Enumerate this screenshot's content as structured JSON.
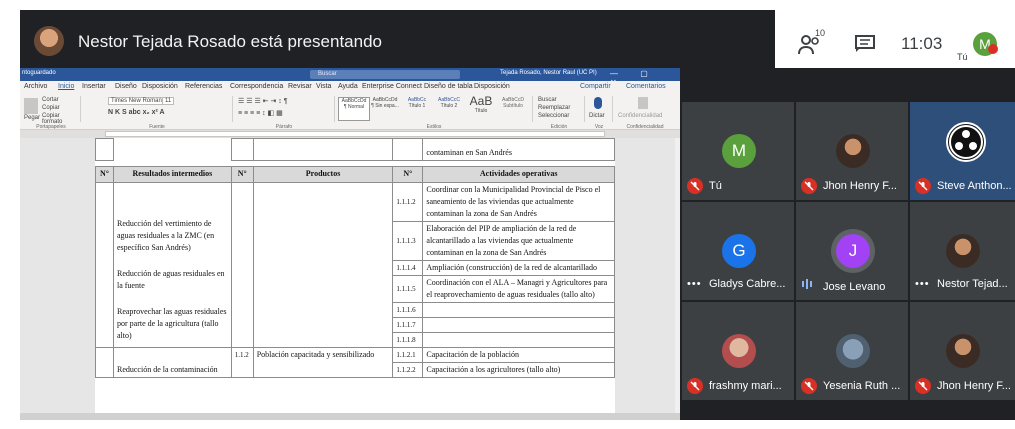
{
  "presenter": {
    "text": "Nestor Tejada Rosado está presentando"
  },
  "topbar": {
    "people_count": "10",
    "clock": "11:03",
    "me_initial": "M",
    "me_label": "Tú"
  },
  "word": {
    "title_toggle": "ntoguardado",
    "search_placeholder": "Buscar",
    "user_text": "Tejada Rosado, Nestor Raul (UC PI)",
    "menu": [
      "Archivo",
      "Inicio",
      "Insertar",
      "Diseño",
      "Disposición",
      "Referencias",
      "Correspondencia",
      "Revisar",
      "Vista",
      "Ayuda",
      "Enterprise Connect",
      "Diseño de tabla",
      "Disposición"
    ],
    "menu_right": [
      "Compartir",
      "Comentarios"
    ],
    "ribbon": {
      "font_name": "Times New Roman",
      "font_size": "11",
      "paste_label": "Pegar",
      "cut_label": "Cortar",
      "copy_label": "Copiar",
      "format_label": "Copiar formato",
      "groups": [
        "Portapapeles",
        "Fuente",
        "Párrafo",
        "Estilos",
        "Edición",
        "Voz",
        "Confidencialidad"
      ],
      "styles": [
        "AaBbCcDd",
        "AaBbCcDd",
        "AaBbCc",
        "AaBbCcC",
        "AaB",
        "AaBbCcD"
      ],
      "style_names": [
        "¶ Normal",
        "¶ Sin espa...",
        "Título 1",
        "Título 2",
        "Título",
        "Subtítulo"
      ],
      "edit_items": [
        "Buscar",
        "Reemplazar",
        "Seleccionar"
      ],
      "voice_label": "Dictar",
      "conf_label": "Confidencialidad"
    },
    "table": {
      "top_cell": "contaminan en San Andrés",
      "headers": [
        "N°",
        "Resultados intermedios",
        "N°",
        "Productos",
        "N°",
        "Actividades operativas"
      ],
      "results": [
        "Reducción del vertimiento de aguas residuales a la ZMC (en específico San Andrés)",
        "Reducción de aguas residuales en la fuente",
        "Reaprovechar las aguas residuales por parte de la agricultura (tallo alto)",
        "Reducción de la contaminación"
      ],
      "product_num": "1.1.2",
      "product": "Población capacitada y sensibilizado",
      "activities": [
        {
          "num": "1.1.1.2",
          "text": "Coordinar con la Municipalidad Provincial de Pisco el saneamiento de las viviendas que actualmente contaminan la zona de San Andrés"
        },
        {
          "num": "1.1.1.3",
          "text": "Elaboración del PIP de ampliación de la red de alcantarillado a las viviendas que actualmente contaminan en la zona de San Andrés"
        },
        {
          "num": "1.1.1.4",
          "text": "Ampliación (construcción) de la red de alcantarillado"
        },
        {
          "num": "1.1.1.5",
          "text": "Coordinación con el ALA – Managri y Agricultores para el reaprovechamiento de aguas residuales (tallo alto)"
        },
        {
          "num": "1.1.1.6",
          "text": ""
        },
        {
          "num": "1.1.1.7",
          "text": ""
        },
        {
          "num": "1.1.1.8",
          "text": ""
        },
        {
          "num": "1.1.2.1",
          "text": "Capacitación de la población"
        },
        {
          "num": "1.1.2.2",
          "text": "Capacitación a los agricultores (tallo alto)"
        }
      ]
    }
  },
  "participants": [
    {
      "name": "Tú",
      "initial": "M",
      "color": "#5aa03c",
      "status": "muted",
      "kind": "initial"
    },
    {
      "name": "Jhon Henry F...",
      "initial": "",
      "color": "",
      "status": "muted",
      "kind": "photo"
    },
    {
      "name": "Steve Anthon...",
      "initial": "",
      "color": "",
      "status": "muted",
      "kind": "obs"
    },
    {
      "name": "Gladys Cabre...",
      "initial": "G",
      "color": "#1a73e8",
      "status": "dots",
      "kind": "initial"
    },
    {
      "name": "Jose Levano",
      "initial": "J",
      "color": "#a142f4",
      "status": "speaking",
      "kind": "initial"
    },
    {
      "name": "Nestor Tejad...",
      "initial": "",
      "color": "",
      "status": "dots",
      "kind": "photo"
    },
    {
      "name": "frashmy mari...",
      "initial": "",
      "color": "",
      "status": "muted",
      "kind": "photo-c"
    },
    {
      "name": "Yesenia Ruth ...",
      "initial": "",
      "color": "",
      "status": "muted",
      "kind": "photo-b"
    },
    {
      "name": "Jhon Henry F...",
      "initial": "",
      "color": "",
      "status": "muted",
      "kind": "photo"
    }
  ]
}
